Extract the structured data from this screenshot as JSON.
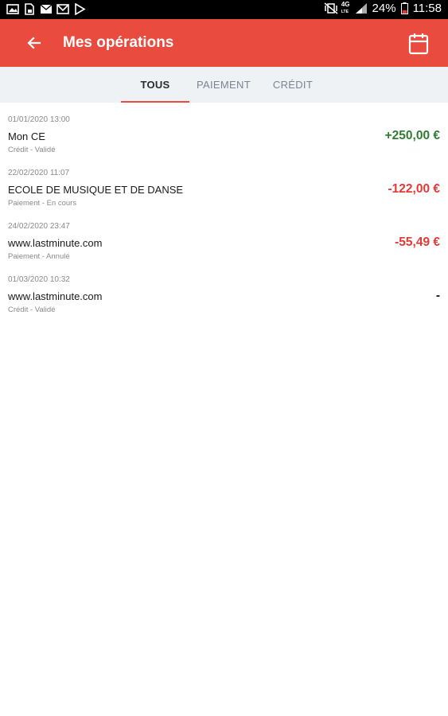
{
  "status_bar": {
    "battery": "24%",
    "time": "11:58",
    "network": "4G",
    "network_sub": "LTE",
    "icons": [
      "gallery-icon",
      "sim-icon",
      "mail-icon",
      "gmail-icon",
      "play-store-icon",
      "vibrate-icon",
      "signal-icon",
      "battery-icon"
    ]
  },
  "app_bar": {
    "title": "Mes opérations",
    "back_icon": "arrow-left-icon",
    "calendar_icon": "calendar-icon",
    "color": "#e94b3f"
  },
  "tabs": [
    {
      "label": "TOUS",
      "active": true
    },
    {
      "label": "PAIEMENT",
      "active": false
    },
    {
      "label": "CRÉDIT",
      "active": false
    }
  ],
  "transactions": [
    {
      "date": "01/01/2020 13:00",
      "name": "Mon CE",
      "status": "Crédit - Validé",
      "amount": "+250,00 €",
      "kind": "positive"
    },
    {
      "date": "22/02/2020 11:07",
      "name": "ECOLE DE MUSIQUE ET DE DANSE",
      "status": "Paiement - En cours",
      "amount": "-122,00 €",
      "kind": "negative"
    },
    {
      "date": "24/02/2020 23:47",
      "name": "www.lastminute.com",
      "status": "Paiement - Annulé",
      "amount": "-55,49 €",
      "kind": "negative"
    },
    {
      "date": "01/03/2020 10:32",
      "name": "www.lastminute.com",
      "status": "Crédit - Validé",
      "amount": "-",
      "kind": "neutral"
    }
  ],
  "colors": {
    "positive": "#2e7d32",
    "negative": "#e53935",
    "tab_bg": "#eef2f5"
  }
}
